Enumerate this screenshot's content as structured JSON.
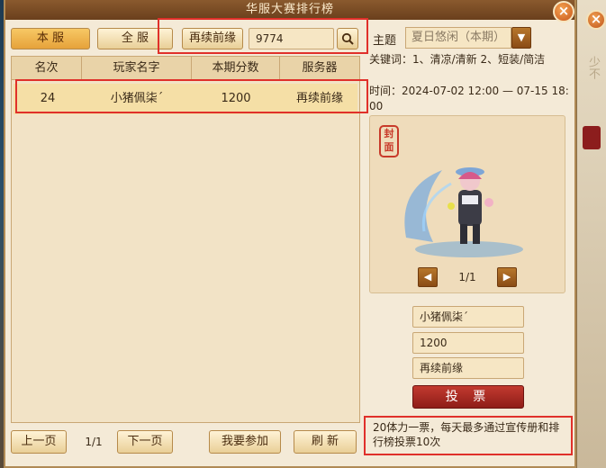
{
  "window": {
    "title": "华服大赛排行榜"
  },
  "tabs": {
    "local": "本 服",
    "all": "全 服"
  },
  "search": {
    "server_button": "再续前缘",
    "value": "9774"
  },
  "table": {
    "columns": [
      "名次",
      "玩家名字",
      "本期分数",
      "服务器"
    ],
    "rows": [
      {
        "rank": "24",
        "player": "小猪佩柒´",
        "score": "1200",
        "server": "再续前缘"
      }
    ]
  },
  "pagination": {
    "prev": "上一页",
    "indicator": "1/1",
    "next": "下一页"
  },
  "actions": {
    "join": "我要参加",
    "refresh": "刷 新"
  },
  "theme": {
    "label": "主题",
    "selected": "夏日悠闲（本期）",
    "keywords": "关键词：1、清凉/清新 2、短装/简洁",
    "time": "时间：2024-07-02 12:00 — 07-15 18:00"
  },
  "preview": {
    "seal": "封面",
    "counter": "1/1"
  },
  "details": {
    "player": "小猪佩柒´",
    "score": "1200",
    "server": "再续前缘"
  },
  "vote": {
    "label": "投 票"
  },
  "notice": "20体力一票，每天最多通过宣传册和排行榜投票10次",
  "background": {
    "side_text": "少不"
  },
  "colors": {
    "highlight_border": "#e0302a",
    "vote_button": "#b02b24",
    "selected_row": "#f5dfa6"
  }
}
